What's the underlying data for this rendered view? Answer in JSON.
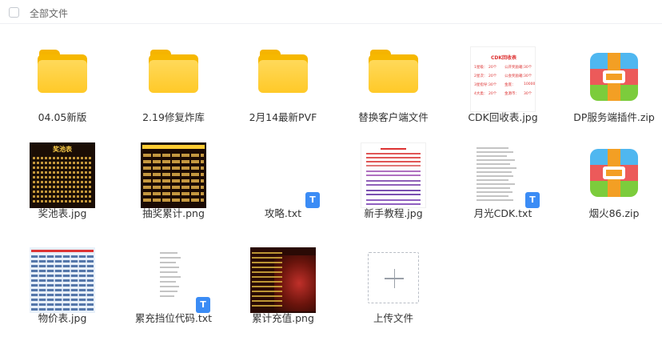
{
  "toolbar": {
    "select_all_label": "全部文件"
  },
  "files": [
    {
      "name": "04.05新版",
      "type": "folder",
      "icon": "folder-icon"
    },
    {
      "name": "2.19修复炸库",
      "type": "folder",
      "icon": "folder-icon"
    },
    {
      "name": "2月14最新PVF",
      "type": "folder",
      "icon": "folder-icon"
    },
    {
      "name": "替换客户端文件",
      "type": "folder",
      "icon": "folder-icon"
    },
    {
      "name": "CDK回收表.jpg",
      "type": "image"
    },
    {
      "name": "DP服务端插件.zip",
      "type": "zip",
      "icon": "zip-icon"
    },
    {
      "name": "奖池表.jpg",
      "type": "image"
    },
    {
      "name": "抽奖累计.png",
      "type": "image"
    },
    {
      "name": "攻略.txt",
      "type": "txt"
    },
    {
      "name": "新手教程.jpg",
      "type": "image"
    },
    {
      "name": "月光CDK.txt",
      "type": "txt"
    },
    {
      "name": "烟火86.zip",
      "type": "zip",
      "icon": "zip-icon"
    },
    {
      "name": "物价表.jpg",
      "type": "image"
    },
    {
      "name": "累充挡位代码.txt",
      "type": "txt"
    },
    {
      "name": "累计充值.png",
      "type": "image"
    },
    {
      "name": "上传文件",
      "type": "upload",
      "icon": "plus-icon"
    }
  ],
  "thumbnails": {
    "cdk": {
      "title": "CDK回收表",
      "cells": [
        "1星级：",
        "20个",
        "公开奖励箱：",
        "30个",
        "2星次：",
        "20个",
        "公会奖励箱：",
        "30个",
        "3星指导：",
        "30个",
        "金底：",
        "10000",
        "4大类：",
        "20个",
        "金源币：",
        "30个"
      ]
    },
    "jiangchi_title": "奖池表",
    "txt_badge": "T"
  },
  "colors": {
    "folder": "#ffc928",
    "txt_badge": "#3b8cf5",
    "zip_top": "#4fb7f0",
    "zip_mid": "#ec5a5a",
    "zip_bottom": "#7ccc3c"
  }
}
